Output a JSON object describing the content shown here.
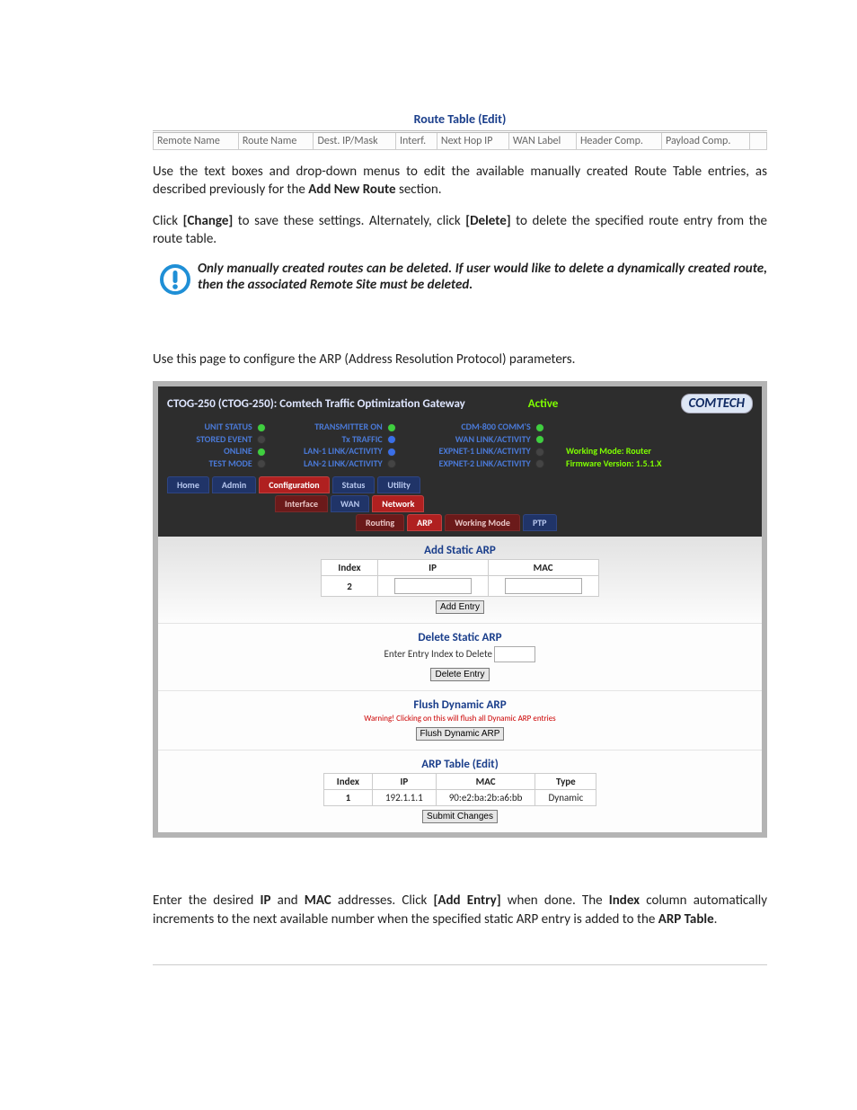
{
  "route_edit": {
    "title": "Route Table (Edit)",
    "headers": [
      "Remote Name",
      "Route Name",
      "Dest. IP/Mask",
      "Interf.",
      "Next Hop IP",
      "WAN Label",
      "Header Comp.",
      "Payload Comp."
    ]
  },
  "para1_a": "Use the text boxes and drop-down menus to edit the available manually created Route Table entries, as described previously for the ",
  "para1_b": "Add New Route",
  "para1_c": " section.",
  "para2_a": "Click ",
  "para2_b": "[Change]",
  "para2_c": " to save these settings. Alternately, click ",
  "para2_d": "[Delete]",
  "para2_e": " to delete the specified route entry from the route table.",
  "note": "Only manually created routes can be deleted. If user would like to delete a dynamically created route, then the associated Remote Site must be deleted.",
  "intro_arp": "Use this page to configure the ARP (Address Resolution Protocol) parameters.",
  "shot": {
    "title": "CTOG-250 (CTOG-250): Comtech Traffic Optimization Gateway",
    "active": "Active",
    "logo": "COMTECH",
    "col1": [
      "UNIT STATUS",
      "STORED EVENT",
      "ONLINE",
      "TEST MODE"
    ],
    "col2": [
      "TRANSMITTER ON",
      "Tx TRAFFIC",
      "LAN-1 LINK/ACTIVITY",
      "LAN-2 LINK/ACTIVITY"
    ],
    "col3": [
      "CDM-800 COMM'S",
      "WAN LINK/ACTIVITY",
      "EXPNET-1 LINK/ACTIVITY",
      "EXPNET-2 LINK/ACTIVITY"
    ],
    "mode_label": "Working Mode:",
    "mode_value": "Router",
    "fw_label": "Firmware Version:",
    "fw_value": "1.5.1.X",
    "tabs_r1": [
      "Home",
      "Admin",
      "Configuration",
      "Status",
      "Utility"
    ],
    "tabs_r2": [
      "Interface",
      "WAN",
      "Network"
    ],
    "tabs_r3": [
      "Routing",
      "ARP",
      "Working Mode",
      "PTP"
    ],
    "add": {
      "title": "Add Static ARP",
      "headers": [
        "Index",
        "IP",
        "MAC"
      ],
      "index_value": "2",
      "button": "Add Entry"
    },
    "del": {
      "title": "Delete Static ARP",
      "label": "Enter Entry Index to Delete",
      "button": "Delete Entry"
    },
    "flush": {
      "title": "Flush Dynamic ARP",
      "warning": "Warning! Clicking on this will flush all Dynamic ARP entries",
      "button": "Flush Dynamic ARP"
    },
    "arp_edit": {
      "title": "ARP Table (Edit)",
      "headers": [
        "Index",
        "IP",
        "MAC",
        "Type"
      ],
      "row": [
        "1",
        "192.1.1.1",
        "90:e2:ba:2b:a6:bb",
        "Dynamic"
      ],
      "button": "Submit Changes"
    }
  },
  "end_a": "Enter the desired ",
  "end_b": "IP",
  "end_c": " and ",
  "end_d": "MAC",
  "end_e": " addresses. Click ",
  "end_f": "[Add Entry]",
  "end_g": " when done. The ",
  "end_h": "Index",
  "end_i": " column automatically increments to the next available number when the specified static ARP entry is added to the ",
  "end_j": "ARP Table",
  "end_k": "."
}
